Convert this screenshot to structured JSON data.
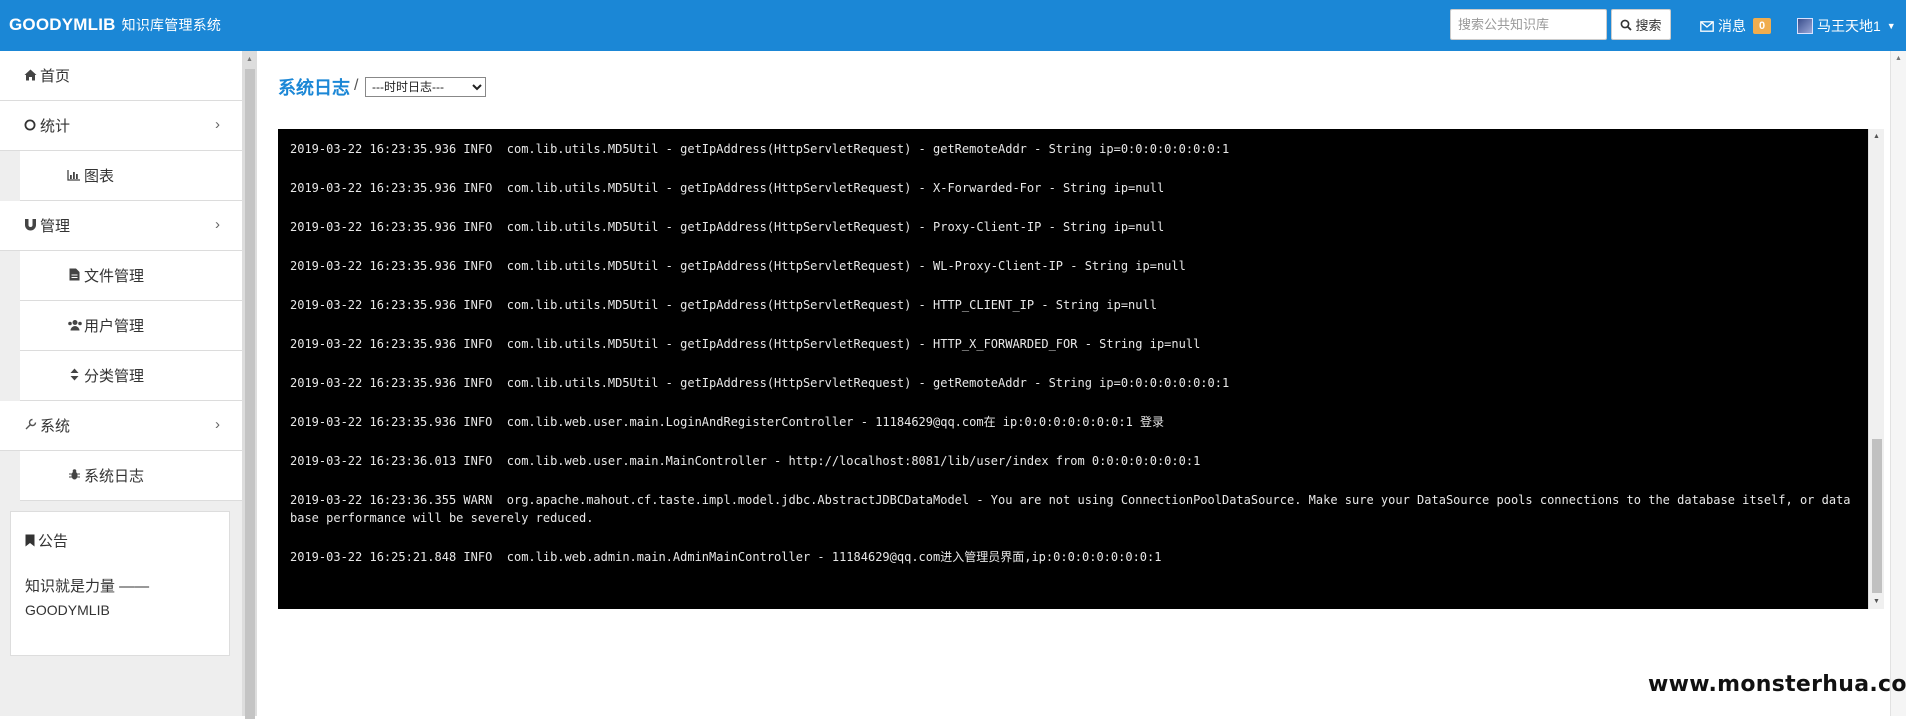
{
  "app": {
    "brand": "GOODYMLIB",
    "brand_sub": "知识库管理系统"
  },
  "header": {
    "search_placeholder": "搜索公共知识库",
    "search_button": "搜索",
    "messages_label": "消息",
    "messages_count": "0",
    "user_name": "马王天地1"
  },
  "sidebar": {
    "items": [
      {
        "label": "首页",
        "icon": "home-icon"
      },
      {
        "label": "统计",
        "icon": "circle-icon"
      },
      {
        "label": "图表",
        "icon": "bar-chart-icon"
      },
      {
        "label": "管理",
        "icon": "magnet-icon"
      },
      {
        "label": "文件管理",
        "icon": "file-icon"
      },
      {
        "label": "用户管理",
        "icon": "users-icon"
      },
      {
        "label": "分类管理",
        "icon": "sort-icon"
      },
      {
        "label": "系统",
        "icon": "wrench-icon"
      },
      {
        "label": "系统日志",
        "icon": "bug-icon"
      }
    ],
    "notice": {
      "title": "公告",
      "line1": "知识就是力量 ——",
      "line2": "GOODYMLIB"
    }
  },
  "main": {
    "title": "系统日志",
    "separator": "/",
    "log_select": {
      "selected": "---时时日志---"
    },
    "log_lines": [
      "2019-03-22 16:23:35.936 INFO  com.lib.utils.MD5Util - getIpAddress(HttpServletRequest) - getRemoteAddr - String ip=0:0:0:0:0:0:0:1",
      "2019-03-22 16:23:35.936 INFO  com.lib.utils.MD5Util - getIpAddress(HttpServletRequest) - X-Forwarded-For - String ip=null",
      "2019-03-22 16:23:35.936 INFO  com.lib.utils.MD5Util - getIpAddress(HttpServletRequest) - Proxy-Client-IP - String ip=null",
      "2019-03-22 16:23:35.936 INFO  com.lib.utils.MD5Util - getIpAddress(HttpServletRequest) - WL-Proxy-Client-IP - String ip=null",
      "2019-03-22 16:23:35.936 INFO  com.lib.utils.MD5Util - getIpAddress(HttpServletRequest) - HTTP_CLIENT_IP - String ip=null",
      "2019-03-22 16:23:35.936 INFO  com.lib.utils.MD5Util - getIpAddress(HttpServletRequest) - HTTP_X_FORWARDED_FOR - String ip=null",
      "2019-03-22 16:23:35.936 INFO  com.lib.utils.MD5Util - getIpAddress(HttpServletRequest) - getRemoteAddr - String ip=0:0:0:0:0:0:0:1",
      "2019-03-22 16:23:35.936 INFO  com.lib.web.user.main.LoginAndRegisterController - 11184629@qq.com在 ip:0:0:0:0:0:0:0:1 登录",
      "2019-03-22 16:23:36.013 INFO  com.lib.web.user.main.MainController - http://localhost:8081/lib/user/index from 0:0:0:0:0:0:0:1",
      "2019-03-22 16:23:36.355 WARN  org.apache.mahout.cf.taste.impl.model.jdbc.AbstractJDBCDataModel - You are not using ConnectionPoolDataSource. Make sure your DataSource pools connections to the database itself, or database performance will be severely reduced.",
      "2019-03-22 16:25:21.848 INFO  com.lib.web.admin.main.AdminMainController - 11184629@qq.com进入管理员界面,ip:0:0:0:0:0:0:0:1"
    ]
  },
  "watermark": "www.monsterhua.com"
}
